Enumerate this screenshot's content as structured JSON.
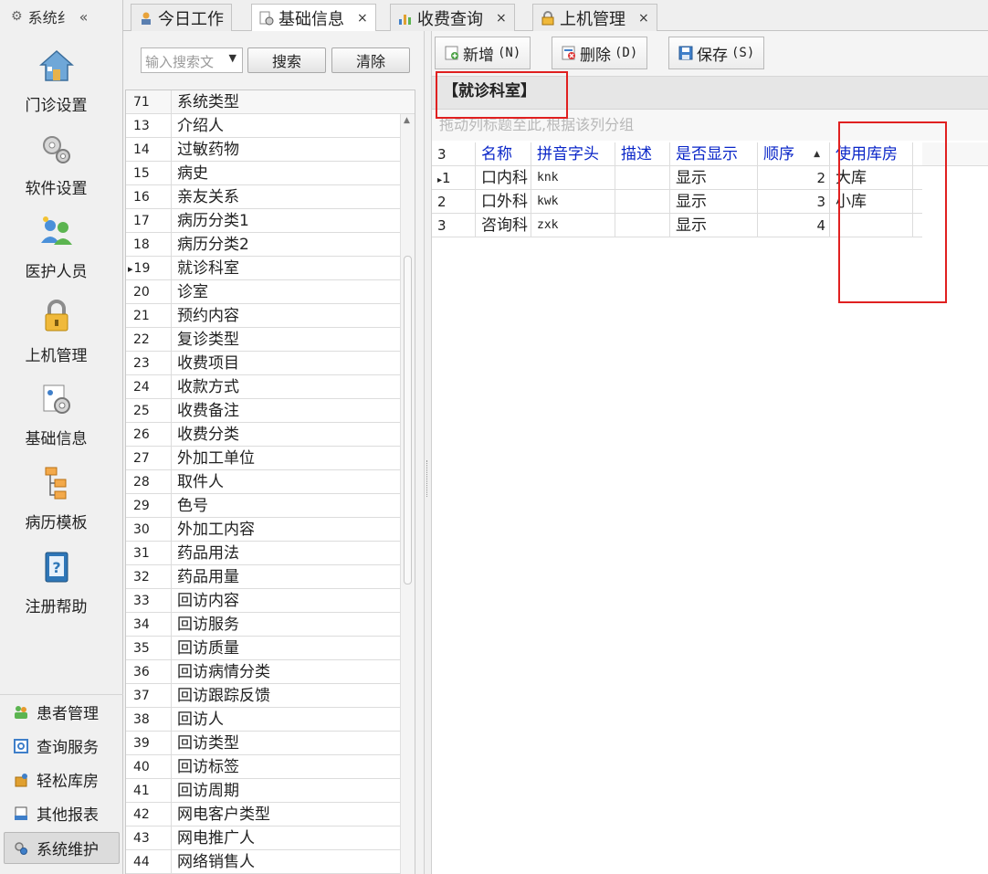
{
  "nav": {
    "header_label": "系统纟",
    "collapse_glyph": "«",
    "big_items": [
      {
        "label": "门诊设置",
        "icon": "home-icon"
      },
      {
        "label": "软件设置",
        "icon": "gears-icon"
      },
      {
        "label": "医护人员",
        "icon": "users-icon"
      },
      {
        "label": "上机管理",
        "icon": "lock-icon"
      },
      {
        "label": "基础信息",
        "icon": "info-gear-icon"
      },
      {
        "label": "病历模板",
        "icon": "tree-icon"
      },
      {
        "label": "注册帮助",
        "icon": "help-book-icon"
      }
    ],
    "small_items": [
      {
        "label": "患者管理",
        "icon": "patients-icon"
      },
      {
        "label": "查询服务",
        "icon": "query-icon"
      },
      {
        "label": "轻松库房",
        "icon": "warehouse-icon"
      },
      {
        "label": "其他报表",
        "icon": "report-icon"
      },
      {
        "label": "系统维护",
        "icon": "gear-icon",
        "active": true
      }
    ]
  },
  "tabs": [
    {
      "label": "今日工作",
      "icon": "worker-icon",
      "active": false,
      "closable": false
    },
    {
      "label": "基础信息",
      "icon": "info-gear-icon",
      "active": true,
      "closable": true
    },
    {
      "label": "收费查询",
      "icon": "chart-icon",
      "active": false,
      "closable": true
    },
    {
      "label": "上机管理",
      "icon": "lock-icon",
      "active": false,
      "closable": true
    }
  ],
  "tab_close_glyph": "×",
  "middle": {
    "search_placeholder": "输入搜索文",
    "search_button": "搜索",
    "clear_button": "清除",
    "header": {
      "id": "71",
      "name": "系统类型"
    },
    "rows": [
      {
        "id": "13",
        "name": "介绍人"
      },
      {
        "id": "14",
        "name": "过敏药物"
      },
      {
        "id": "15",
        "name": "病史"
      },
      {
        "id": "16",
        "name": "亲友关系"
      },
      {
        "id": "17",
        "name": "病历分类1"
      },
      {
        "id": "18",
        "name": "病历分类2"
      },
      {
        "id": "19",
        "name": "就诊科室",
        "current": true
      },
      {
        "id": "20",
        "name": "诊室"
      },
      {
        "id": "21",
        "name": "预约内容"
      },
      {
        "id": "22",
        "name": "复诊类型"
      },
      {
        "id": "23",
        "name": "收费项目"
      },
      {
        "id": "24",
        "name": "收款方式"
      },
      {
        "id": "25",
        "name": "收费备注"
      },
      {
        "id": "26",
        "name": "收费分类"
      },
      {
        "id": "27",
        "name": "外加工单位"
      },
      {
        "id": "28",
        "name": "取件人"
      },
      {
        "id": "29",
        "name": "色号"
      },
      {
        "id": "30",
        "name": "外加工内容"
      },
      {
        "id": "31",
        "name": "药品用法"
      },
      {
        "id": "32",
        "name": "药品用量"
      },
      {
        "id": "33",
        "name": "回访内容"
      },
      {
        "id": "34",
        "name": "回访服务"
      },
      {
        "id": "35",
        "name": "回访质量"
      },
      {
        "id": "36",
        "name": "回访病情分类"
      },
      {
        "id": "37",
        "name": "回访跟踪反馈"
      },
      {
        "id": "38",
        "name": "回访人"
      },
      {
        "id": "39",
        "name": "回访类型"
      },
      {
        "id": "40",
        "name": "回访标签"
      },
      {
        "id": "41",
        "name": "回访周期"
      },
      {
        "id": "42",
        "name": "网电客户类型"
      },
      {
        "id": "43",
        "name": "网电推广人"
      },
      {
        "id": "44",
        "name": "网络销售人"
      }
    ]
  },
  "right": {
    "toolbar": [
      {
        "label": "新增",
        "key": "(N)",
        "icon": "add-icon"
      },
      {
        "label": "删除",
        "key": "(D)",
        "icon": "delete-icon"
      },
      {
        "label": "保存",
        "key": "(S)",
        "icon": "save-icon"
      }
    ],
    "title": "【就诊科室】",
    "group_hint": "拖动列标题至此,根据该列分组",
    "columns": [
      "3",
      "名称",
      "拼音字头",
      "描述",
      "是否显示",
      "顺序",
      "使用库房"
    ],
    "sort_glyph": "▲",
    "rows": [
      {
        "no": "1",
        "name": "口内科",
        "pinyin": "knk",
        "desc": "",
        "show": "显示",
        "order": "2",
        "store": "大库",
        "current": true
      },
      {
        "no": "2",
        "name": "口外科",
        "pinyin": "kwk",
        "desc": "",
        "show": "显示",
        "order": "3",
        "store": "小库"
      },
      {
        "no": "3",
        "name": "咨询科",
        "pinyin": "zxk",
        "desc": "",
        "show": "显示",
        "order": "4",
        "store": ""
      }
    ]
  },
  "colors": {
    "highlight_box": "#e02020",
    "header_text": "#0a26c8"
  }
}
